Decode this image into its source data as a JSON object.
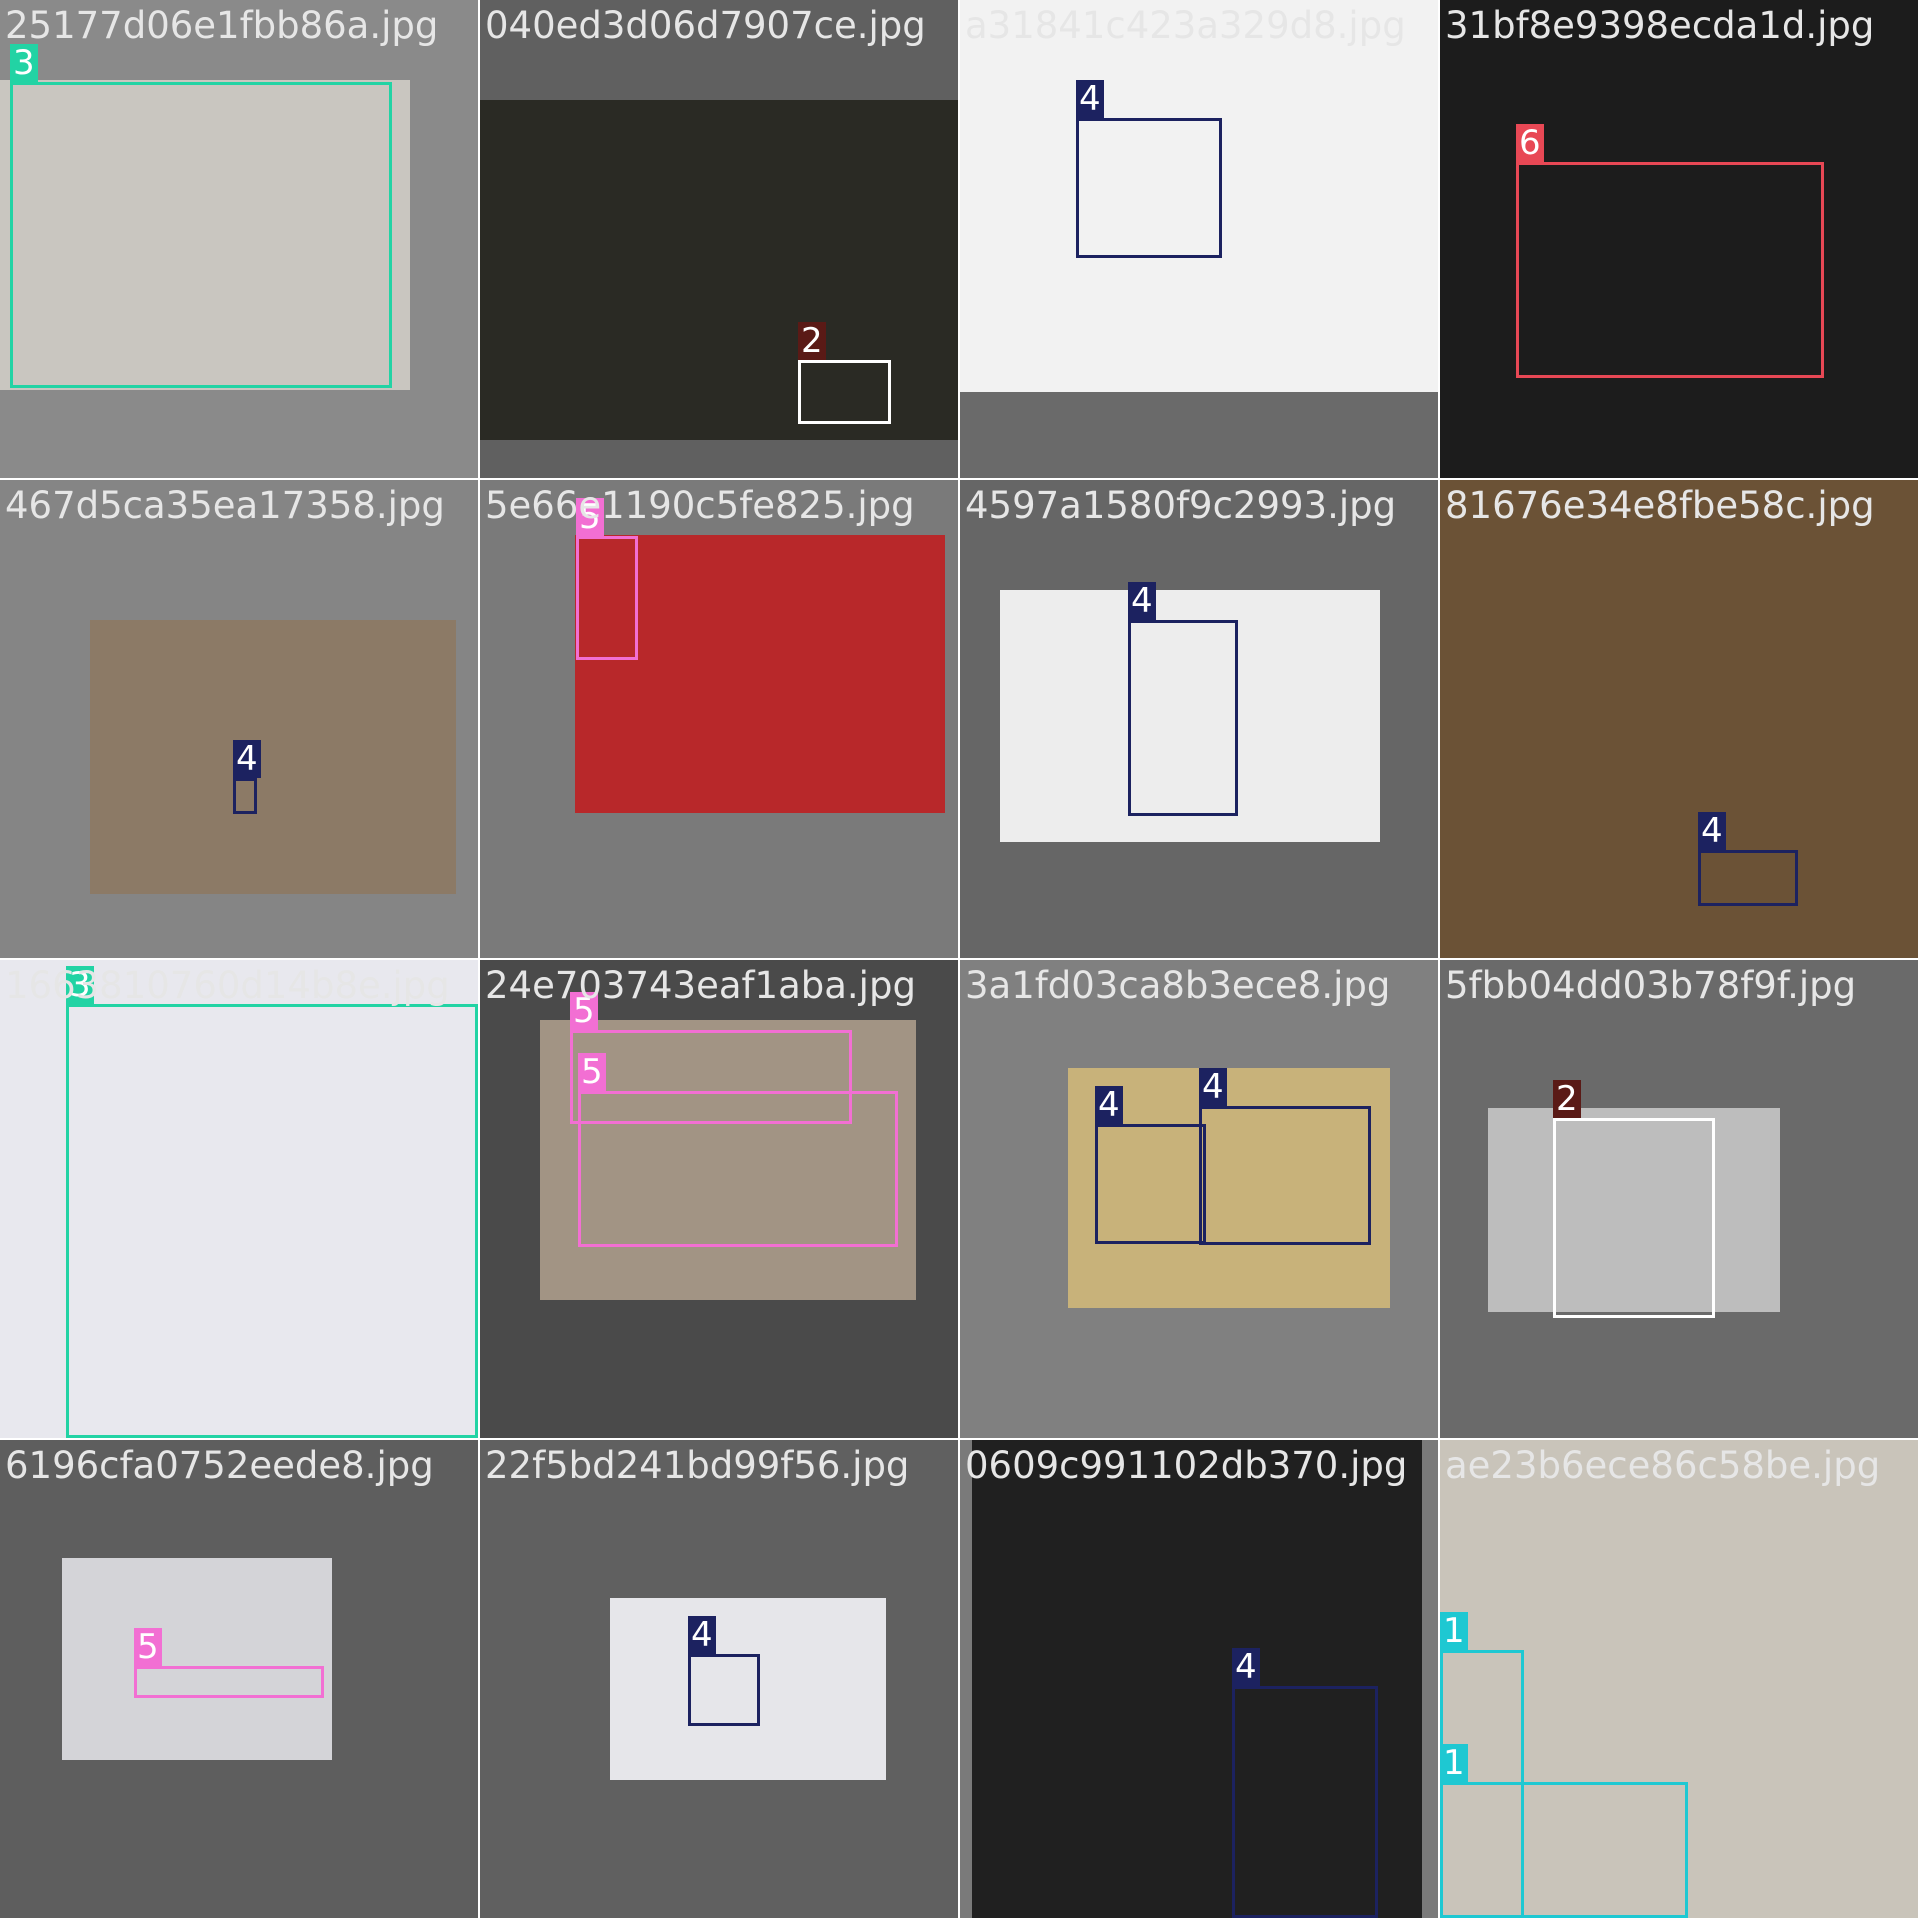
{
  "title": "",
  "class_colors": {
    "1": "#1ec8d2",
    "2": "#ffffff",
    "3": "#22d3a4",
    "4": "#1c2260",
    "5": "#f26fd3",
    "6": "#e84855"
  },
  "label_colors": {
    "1": "#1ec8d2",
    "2": "#5a1a16",
    "3": "#22d3a4",
    "4": "#1c2260",
    "5": "#f26fd3",
    "6": "#e84855"
  },
  "tiles": [
    {
      "filename": "25177d06e1fbb86a.jpg",
      "bg": "#8a8a8a",
      "photo_color": "#c9c6c0",
      "boxes": [
        {
          "label": "3"
        }
      ]
    },
    {
      "filename": "040ed3d06d7907ce.jpg",
      "bg": "#606060",
      "photo_color": "#2a2a24",
      "boxes": [
        {
          "label": "2"
        }
      ]
    },
    {
      "filename": "a31841c423a329d8.jpg",
      "bg": "#6a6a6a",
      "photo_color": "#f2f2f2",
      "boxes": [
        {
          "label": "4"
        }
      ]
    },
    {
      "filename": "31bf8e9398ecda1d.jpg",
      "bg": "#555555",
      "photo_color": "#1c1c1c",
      "boxes": [
        {
          "label": "6"
        }
      ]
    },
    {
      "filename": "467d5ca35ea17358.jpg",
      "bg": "#858585",
      "photo_color": "#8c7a66",
      "boxes": [
        {
          "label": "4"
        }
      ]
    },
    {
      "filename": "5e66e1190c5fe825.jpg",
      "bg": "#7a7a7a",
      "photo_color": "#b8282a",
      "boxes": [
        {
          "label": "5"
        }
      ]
    },
    {
      "filename": "4597a1580f9c2993.jpg",
      "bg": "#666666",
      "photo_color": "#ededed",
      "boxes": [
        {
          "label": "4"
        }
      ]
    },
    {
      "filename": "81676e34e8fbe58c.jpg",
      "bg": "#7a7a7a",
      "photo_color": "#6b5236",
      "boxes": [
        {
          "label": "4"
        }
      ]
    },
    {
      "filename": "1663810760d14b8e.jpg",
      "bg": "#8a8a8a",
      "photo_color": "#e8e8ee",
      "boxes": [
        {
          "label": "3"
        }
      ]
    },
    {
      "filename": "24e703743eaf1aba.jpg",
      "bg": "#4a4a4a",
      "photo_color": "#a29484",
      "boxes": [
        {
          "label": "5"
        },
        {
          "label": "5"
        }
      ]
    },
    {
      "filename": "3a1fd03ca8b3ece8.jpg",
      "bg": "#808080",
      "photo_color": "#c8b27a",
      "boxes": [
        {
          "label": "4"
        },
        {
          "label": "4"
        }
      ]
    },
    {
      "filename": "5fbb04dd03b78f9f.jpg",
      "bg": "#6a6a6a",
      "photo_color": "#bdbdbd",
      "boxes": [
        {
          "label": "2"
        }
      ]
    },
    {
      "filename": "6196cfa0752eede8.jpg",
      "bg": "#5e5e5e",
      "photo_color": "#d4d4d8",
      "boxes": [
        {
          "label": "5"
        }
      ]
    },
    {
      "filename": "22f5bd241bd99f56.jpg",
      "bg": "#606060",
      "photo_color": "#e6e6ea",
      "boxes": [
        {
          "label": "4"
        }
      ]
    },
    {
      "filename": "0609c991102db370.jpg",
      "bg": "#7a7a7a",
      "photo_color": "#202020",
      "boxes": [
        {
          "label": "4"
        }
      ]
    },
    {
      "filename": "ae23b6ece86c58be.jpg",
      "bg": "#b0aca4",
      "photo_color": "#c9c4ba",
      "boxes": [
        {
          "label": "1"
        },
        {
          "label": "1"
        }
      ]
    }
  ]
}
